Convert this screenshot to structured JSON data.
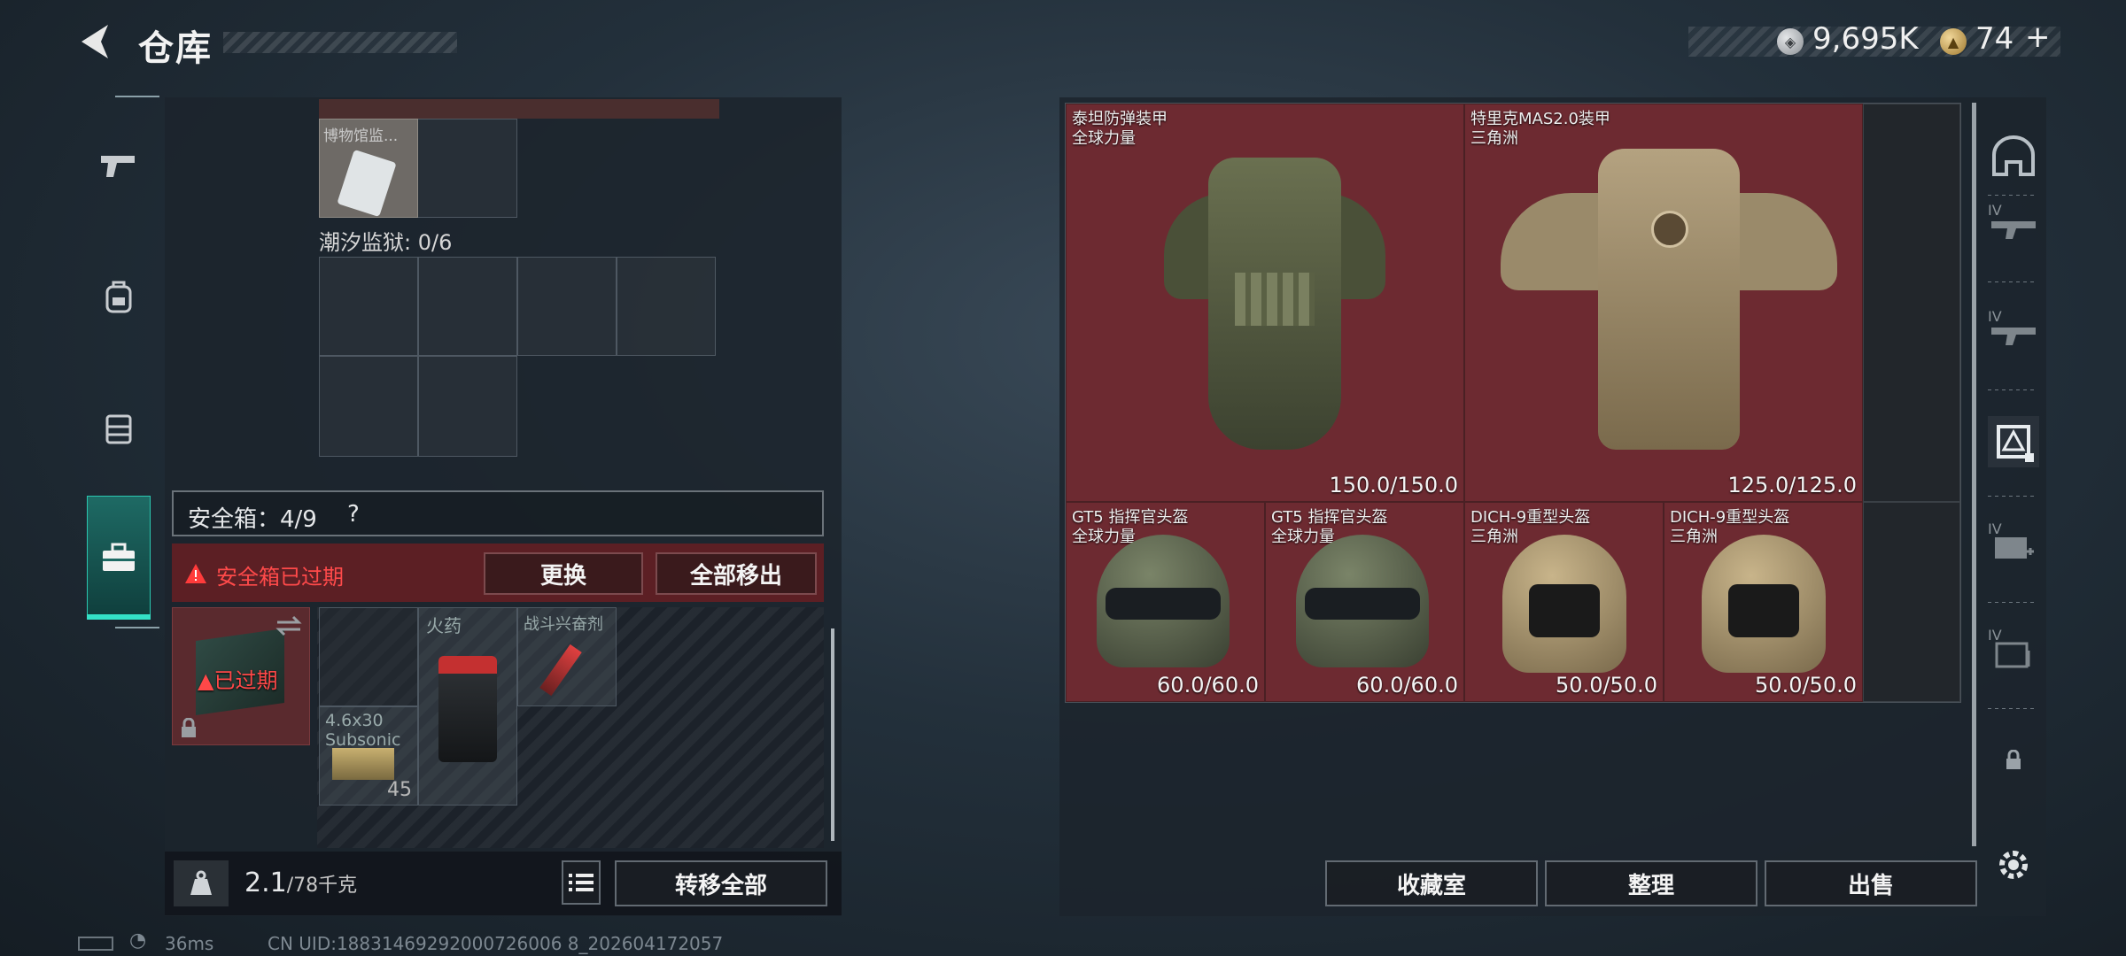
{
  "header": {
    "title": "仓库",
    "silver_amount": "9,695K",
    "gold_amount": "74",
    "gold_plus": "+"
  },
  "sidebar": {
    "items": [
      {
        "name": "weapon"
      },
      {
        "name": "backpack"
      },
      {
        "name": "vest"
      },
      {
        "name": "case",
        "active": true
      }
    ]
  },
  "left_panel": {
    "museum_item_label": "博物馆监...",
    "tide_prison_label": "潮汐监狱: 0/6",
    "safebox_label": "安全箱：4/9",
    "safebox_help": "?",
    "expired_alert": "安全箱已过期",
    "replace_button": "更换",
    "remove_all_button": "全部移出",
    "safebox_expired_badge": "已过期",
    "storage_items": [
      {
        "name": "火药"
      },
      {
        "name": "战斗兴奋剂"
      },
      {
        "name": "4.6x30 Subsonic",
        "count": "45"
      }
    ],
    "weight_current": "2.1",
    "weight_max": "/78千克",
    "transfer_all_button": "转移全部"
  },
  "loot": {
    "items": [
      {
        "name": "泰坦防弹装甲",
        "faction": "全球力量",
        "durability": "150.0/150.0"
      },
      {
        "name": "特里克MAS2.0装甲",
        "faction": "三角洲",
        "durability": "125.0/125.0"
      },
      {
        "name": "GT5 指挥官头盔",
        "faction": "全球力量",
        "durability": "60.0/60.0"
      },
      {
        "name": "GT5 指挥官头盔",
        "faction": "全球力量",
        "durability": "60.0/60.0"
      },
      {
        "name": "DICH-9重型头盔",
        "faction": "三角洲",
        "durability": "50.0/50.0"
      },
      {
        "name": "DICH-9重型头盔",
        "faction": "三角洲",
        "durability": "50.0/50.0"
      }
    ],
    "collection_button": "收藏室",
    "sort_button": "整理",
    "sell_button": "出售"
  },
  "right_rail": {
    "tier_labels": [
      "IV",
      "IV",
      "IV",
      "IV"
    ]
  },
  "status_bar": {
    "ping": "36ms",
    "uid": "CN UID:18831469292000726006 8_202604172057"
  },
  "colors": {
    "accent_teal": "#2bc7b0",
    "loot_red": "#a0323a",
    "alert_red": "#e0303a"
  }
}
